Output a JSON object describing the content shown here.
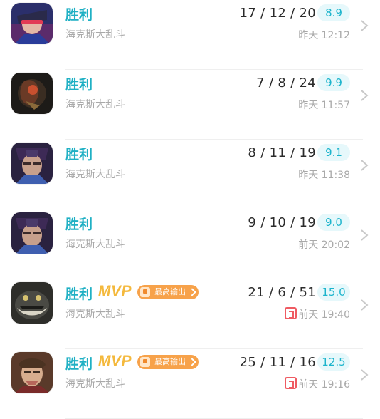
{
  "matches": [
    {
      "result": "胜利",
      "mode": "海克斯大乱斗",
      "kda": "17 / 12 / 20",
      "score": "8.9",
      "time": "昨天 12:12",
      "avatar_icon": "champion-1-avatar",
      "mvp": false
    },
    {
      "result": "胜利",
      "mode": "海克斯大乱斗",
      "kda": "7 / 8 / 24",
      "score": "9.9",
      "time": "昨天 11:57",
      "avatar_icon": "champion-2-avatar",
      "mvp": false
    },
    {
      "result": "胜利",
      "mode": "海克斯大乱斗",
      "kda": "8 / 11 / 19",
      "score": "9.1",
      "time": "昨天 11:38",
      "avatar_icon": "champion-3-avatar",
      "mvp": false
    },
    {
      "result": "胜利",
      "mode": "海克斯大乱斗",
      "kda": "9 / 10 / 19",
      "score": "9.0",
      "time": "前天 20:02",
      "avatar_icon": "champion-3-avatar",
      "mvp": false
    },
    {
      "result": "胜利",
      "mode": "海克斯大乱斗",
      "kda": "21 / 6 / 51",
      "score": "15.0",
      "time": "前天 19:40",
      "avatar_icon": "champion-4-avatar",
      "mvp": true,
      "mvp_label": "MVP",
      "badge_label": "最高输出"
    },
    {
      "result": "胜利",
      "mode": "海克斯大乱斗",
      "kda": "25 / 11 / 16",
      "score": "12.5",
      "time": "前天 19:16",
      "avatar_icon": "champion-5-avatar",
      "mvp": true,
      "mvp_label": "MVP",
      "badge_label": "最高输出"
    }
  ],
  "colors": {
    "result": "#1fb0c4",
    "score_bg": "#e6f8fb",
    "mvp": "#f4b93d",
    "badge": "#f7a24a",
    "flag": "#ef5b62"
  }
}
